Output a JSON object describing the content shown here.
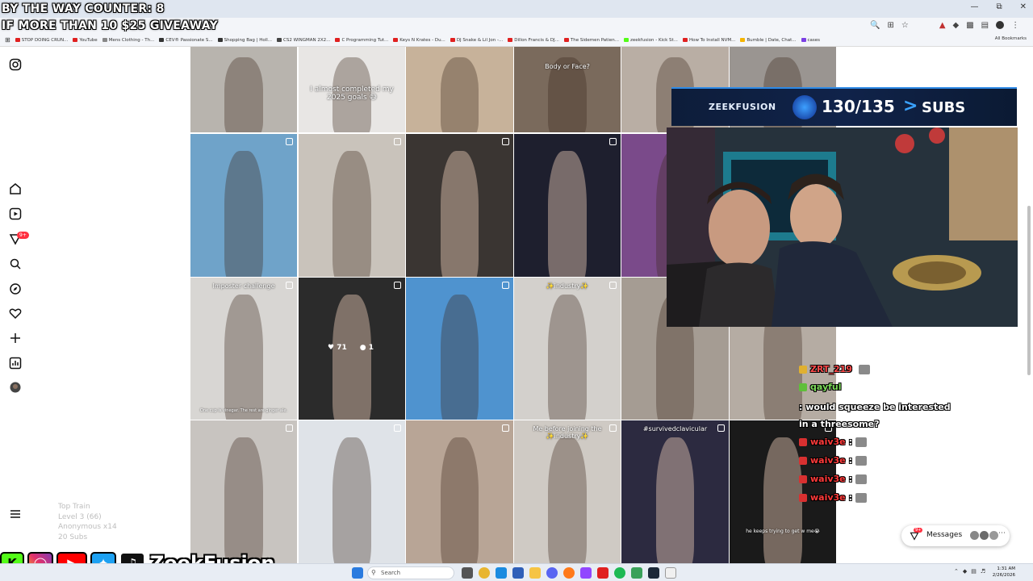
{
  "overlay": {
    "counter_line1": "BY THE WAY COUNTER: 8",
    "counter_line2": "IF MORE THAN 10 $25 GIVEAWAY"
  },
  "browser": {
    "bookmarks": [
      {
        "label": "STOP DOING CRUN...",
        "color": "#e02020"
      },
      {
        "label": "YouTube",
        "color": "#e02020"
      },
      {
        "label": "Mens Clothing - Th...",
        "color": "#888888"
      },
      {
        "label": "CEV® Passionate S...",
        "color": "#333333"
      },
      {
        "label": "Shopping Bag | Holl...",
        "color": "#333333"
      },
      {
        "label": "CS2 WINGMAN 2X2...",
        "color": "#444444"
      },
      {
        "label": "C Programming Tut...",
        "color": "#e02020"
      },
      {
        "label": "Keys N Krates - Du...",
        "color": "#e02020"
      },
      {
        "label": "DJ Snake & Lil Jon -...",
        "color": "#e02020"
      },
      {
        "label": "Dillon Francis & DJ...",
        "color": "#e02020"
      },
      {
        "label": "The Sidemen Patien...",
        "color": "#e02020"
      },
      {
        "label": "zeekfusion - Kick St...",
        "color": "#53fc18"
      },
      {
        "label": "How To Install NVM...",
        "color": "#e02020"
      },
      {
        "label": "Bumble | Date, Chat...",
        "color": "#f5b400"
      },
      {
        "label": "cases",
        "color": "#7b3fe4"
      }
    ],
    "all_bookmarks": "All Bookmarks"
  },
  "grid_cells": [
    {
      "label": "",
      "bg": "#b8b4ae"
    },
    {
      "label": "I almost completed my 2025 goals 😅",
      "bg": "#e8e6e4"
    },
    {
      "label": "",
      "bg": "#c7b29a"
    },
    {
      "label": "Body or Face?",
      "bg": "#7a6a5c"
    },
    {
      "label": "",
      "bg": "#b9aea4"
    },
    {
      "label": "",
      "bg": "#9a9591"
    },
    {
      "label": "",
      "bg": "#6fa3c9"
    },
    {
      "label": "",
      "bg": "#c9c3bb"
    },
    {
      "label": "",
      "bg": "#3a3532"
    },
    {
      "label": "",
      "bg": "#1e1f2e"
    },
    {
      "label": "",
      "bg": "#7a4a8a"
    },
    {
      "label": "",
      "bg": "#3d3b3a"
    },
    {
      "label": "Imposter challenge",
      "bg": "#d8d6d3"
    },
    {
      "label": "",
      "bg": "#2b2b2b"
    },
    {
      "label": "",
      "bg": "#4f93cf"
    },
    {
      "label": "✨industry✨",
      "bg": "#d3d0cc"
    },
    {
      "label": "",
      "bg": "#a59c93"
    },
    {
      "label": "",
      "bg": "#b5aca3"
    },
    {
      "label": "",
      "bg": "#c8c4c0"
    },
    {
      "label": "",
      "bg": "#dfe3e8"
    },
    {
      "label": "",
      "bg": "#b8a596"
    },
    {
      "label": "Me before joining the ✨industry✨",
      "bg": "#cfcac4"
    },
    {
      "label": "#survivedclavicular",
      "bg": "#2c2a40"
    },
    {
      "label": "",
      "bg": "#1a1a1a"
    }
  ],
  "grid_extras": {
    "imposter_caption": "One cup is vinegar. The rest are ginger ale.",
    "likes": "71",
    "comments": "1",
    "cell24_caption": "he keeps trying to get w me😭"
  },
  "sub_goal": {
    "name": "ZEEKFUSION",
    "count": "130/135",
    "arrow": ">",
    "unit": "SUBS"
  },
  "chat": [
    {
      "name": "ZRT_219",
      "message": "",
      "color": "#ff4a4a",
      "badge": "#e0b030"
    },
    {
      "name": "qayful",
      "message": ": would squeeze be interested in a threesome?",
      "color": "#7ddc5a",
      "badge": "#5fbf3a"
    },
    {
      "name": "waiv3e",
      "message": ":",
      "color": "#ff3a3a",
      "badge": "#d83030"
    },
    {
      "name": "waiv3e",
      "message": ":",
      "color": "#ff3a3a",
      "badge": "#d83030"
    },
    {
      "name": "waiv3e",
      "message": ":",
      "color": "#ff3a3a",
      "badge": "#d83030"
    },
    {
      "name": "waiv3e",
      "message": ":",
      "color": "#ff3a3a",
      "badge": "#d83030"
    }
  ],
  "messages": {
    "label": "Messages",
    "badge": "9+"
  },
  "sidebar": {
    "notif_badge": "9+"
  },
  "top_train": {
    "title": "Top Train",
    "level": "Level 3 (66)",
    "anon": "Anonymous x14",
    "subs": "20 Subs"
  },
  "social": {
    "name": "ZeekFusion"
  },
  "taskbar": {
    "search_placeholder": "Search",
    "time": "1:31 AM",
    "date": "2/26/2026"
  }
}
